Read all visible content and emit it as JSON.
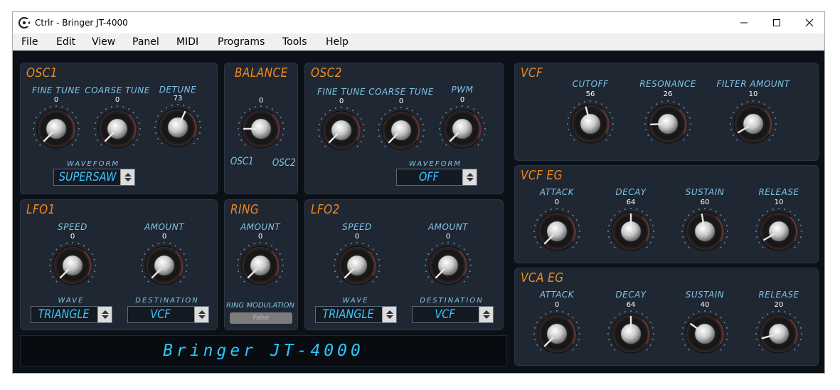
{
  "window": {
    "title": "Ctrlr - Bringer JT-4000",
    "controls": [
      "minimize-icon",
      "maximize-icon",
      "close-icon"
    ]
  },
  "menu": [
    "File",
    "Edit",
    "View",
    "Panel",
    "MIDI",
    "Programs",
    "Tools",
    "Help"
  ],
  "colors": {
    "panel_title": "#f08a1e",
    "label": "#7fc4e6",
    "combo_text": "#39c6ff",
    "lcd_text": "#27c9ff",
    "panel_bg": "#1f2733",
    "canvas_bg": "#0c1118"
  },
  "osc1": {
    "title": "OSC1",
    "fine_tune": {
      "label": "FINE TUNE",
      "value": "0"
    },
    "coarse_tune": {
      "label": "COARSE TUNE",
      "value": "0"
    },
    "detune": {
      "label": "DETUNE",
      "value": "73"
    },
    "waveform_label": "WAVEFORM",
    "waveform": "SUPERSAW"
  },
  "balance": {
    "title": "BALANCE",
    "value": "0",
    "left_label": "OSC1",
    "right_label": "OSC2"
  },
  "osc2": {
    "title": "OSC2",
    "fine_tune": {
      "label": "FINE TUNE",
      "value": "0"
    },
    "coarse_tune": {
      "label": "COARSE TUNE",
      "value": "0"
    },
    "pwm": {
      "label": "PWM",
      "value": "0"
    },
    "waveform_label": "WAVEFORM",
    "waveform": "OFF"
  },
  "lfo1": {
    "title": "LFO1",
    "speed": {
      "label": "SPEED",
      "value": "0"
    },
    "amount": {
      "label": "AMOUNT",
      "value": "0"
    },
    "wave_label": "WAVE",
    "wave": "TRIANGLE",
    "destination_label": "DESTINATION",
    "destination": "VCF"
  },
  "ring": {
    "title": "RING",
    "amount": {
      "label": "AMOUNT",
      "value": "0"
    },
    "modulation_label": "RING MODULATION",
    "modulation_button": "False"
  },
  "lfo2": {
    "title": "LFO2",
    "speed": {
      "label": "SPEED",
      "value": "0"
    },
    "amount": {
      "label": "AMOUNT",
      "value": "0"
    },
    "wave_label": "WAVE",
    "wave": "TRIANGLE",
    "destination_label": "DESTINATION",
    "destination": "VCF"
  },
  "vcf": {
    "title": "VCF",
    "cutoff": {
      "label": "CUTOFF",
      "value": "56"
    },
    "resonance": {
      "label": "RESONANCE",
      "value": "26"
    },
    "filter_amount": {
      "label": "FILTER AMOUNT",
      "value": "10"
    }
  },
  "vcf_eg": {
    "title": "VCF EG",
    "attack": {
      "label": "ATTACK",
      "value": "0"
    },
    "decay": {
      "label": "DECAY",
      "value": "64"
    },
    "sustain": {
      "label": "SUSTAIN",
      "value": "60"
    },
    "release": {
      "label": "RELEASE",
      "value": "10"
    }
  },
  "vca_eg": {
    "title": "VCA EG",
    "attack": {
      "label": "ATTACK",
      "value": "0"
    },
    "decay": {
      "label": "DECAY",
      "value": "64"
    },
    "sustain": {
      "label": "SUSTAIN",
      "value": "40"
    },
    "release": {
      "label": "RELEASE",
      "value": "20"
    }
  },
  "display": {
    "text": "Bringer JT-4000"
  }
}
